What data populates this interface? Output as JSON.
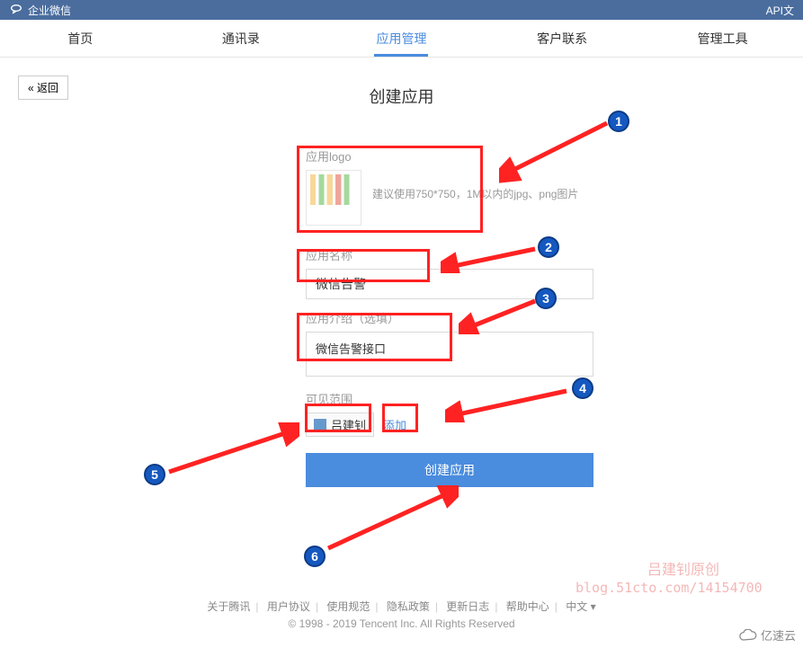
{
  "topbar": {
    "brand": "企业微信",
    "right": "API文"
  },
  "nav": {
    "items": [
      "首页",
      "通讯录",
      "应用管理",
      "客户联系",
      "管理工具"
    ],
    "active_index": 2
  },
  "back_label": "« 返回",
  "page_title": "创建应用",
  "form": {
    "logo": {
      "label": "应用logo",
      "hint": "建议使用750*750，1M以内的jpg、png图片"
    },
    "name": {
      "label": "应用名称",
      "value": "微信告警"
    },
    "desc": {
      "label": "应用介绍（选填）",
      "value": "微信告警接口"
    },
    "scope": {
      "label": "可见范围",
      "user": "吕建钊",
      "add_label": "添加"
    },
    "submit_label": "创建应用"
  },
  "badges": {
    "b1": "1",
    "b2": "2",
    "b3": "3",
    "b4": "4",
    "b5": "5",
    "b6": "6"
  },
  "footer": {
    "links": [
      "关于腾讯",
      "用户协议",
      "使用规范",
      "隐私政策",
      "更新日志",
      "帮助中心",
      "中文 ▾"
    ],
    "copyright": "© 1998 - 2019 Tencent Inc. All Rights Reserved"
  },
  "watermark": {
    "line1": "吕建钊原创",
    "line2": "blog.51cto.com/14154700"
  },
  "cloud_logo": "亿速云"
}
